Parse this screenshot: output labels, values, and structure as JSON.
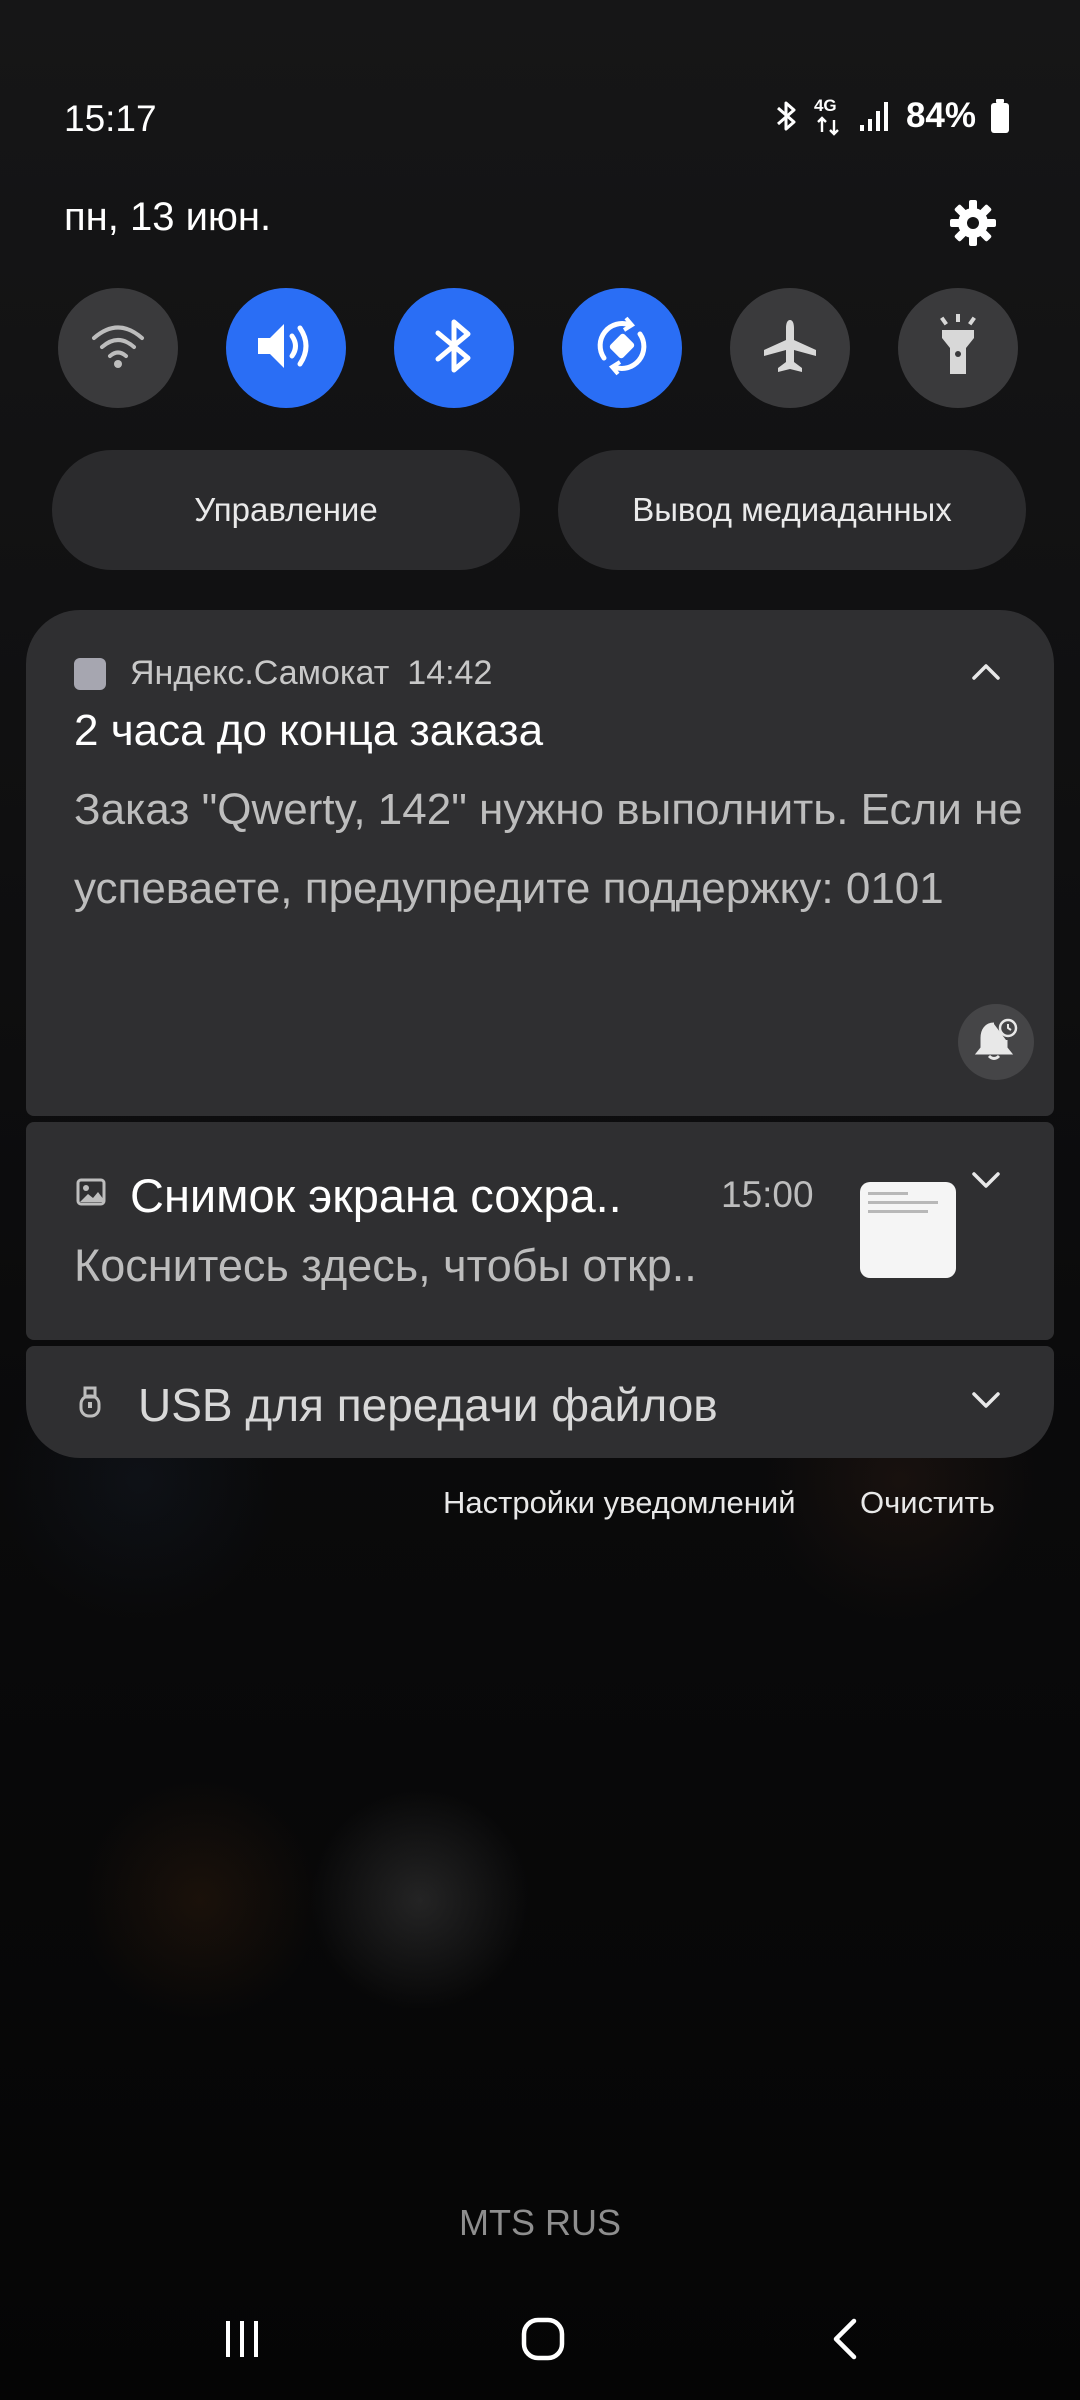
{
  "status_bar": {
    "time": "15:17",
    "network": "4G",
    "battery": "84%"
  },
  "header": {
    "date": "пн, 13 июн."
  },
  "quick_tiles": [
    {
      "name": "wifi",
      "active": false
    },
    {
      "name": "sound",
      "active": true
    },
    {
      "name": "bluetooth",
      "active": true
    },
    {
      "name": "auto-rotate",
      "active": true
    },
    {
      "name": "airplane-mode",
      "active": false
    },
    {
      "name": "flashlight",
      "active": false
    }
  ],
  "buttons": {
    "device_control": "Управление",
    "media_output": "Вывод медиаданных"
  },
  "notifications": {
    "yandex": {
      "app_name": "Яндекс.Самокат",
      "time": "14:42",
      "title": "2 часа до конца заказа",
      "body": "Заказ \"Qwerty, 142\" нужно выполнить. Если не успеваете, предупредите поддержку: 0101"
    },
    "screenshot": {
      "title": "Снимок экрана сохра..",
      "time": "15:00",
      "body": "Коснитесь здесь, чтобы откр.."
    },
    "usb": {
      "title": "USB для передачи файлов"
    }
  },
  "footer": {
    "notification_settings": "Настройки уведомлений",
    "clear": "Очистить"
  },
  "carrier": "MTS RUS",
  "colors": {
    "accent": "#2a6ef5",
    "card": "#2f2f31",
    "tile_off": "#3a3a3c"
  }
}
